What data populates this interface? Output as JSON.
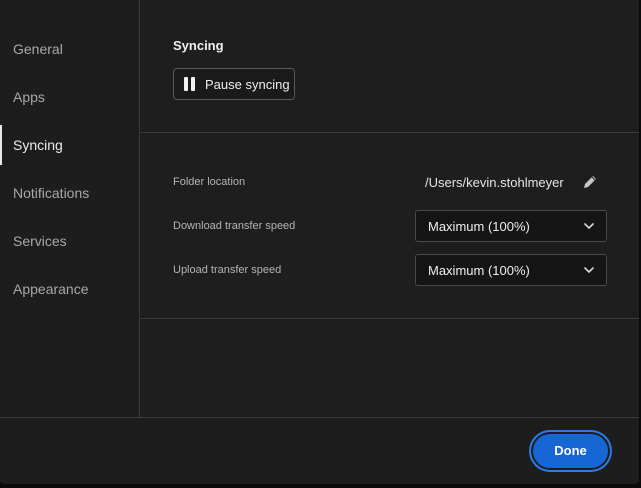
{
  "sidebar": {
    "items": [
      {
        "label": "General"
      },
      {
        "label": "Apps"
      },
      {
        "label": "Syncing",
        "active": true
      },
      {
        "label": "Notifications"
      },
      {
        "label": "Services"
      },
      {
        "label": "Appearance"
      }
    ]
  },
  "syncing": {
    "title": "Syncing",
    "pause_button_label": "Pause syncing",
    "folder_location_label": "Folder location",
    "folder_location_value": "/Users/kevin.stohlmeyer",
    "download_speed_label": "Download transfer speed",
    "download_speed_value": "Maximum (100%)",
    "upload_speed_label": "Upload transfer speed",
    "upload_speed_value": "Maximum (100%)"
  },
  "footer": {
    "done_label": "Done"
  },
  "colors": {
    "background": "#1e1e1e",
    "accent": "#1766d6",
    "text": "#ececec"
  },
  "icons": [
    "pause-icon",
    "pencil-icon",
    "chevron-down-icon"
  ]
}
